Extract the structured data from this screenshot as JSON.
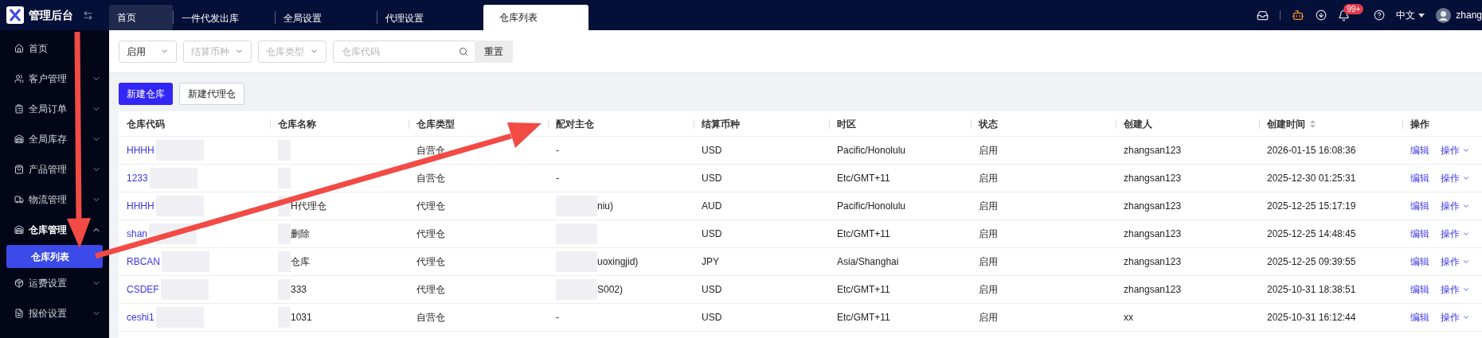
{
  "app": {
    "title": "管理后台"
  },
  "tabs": [
    {
      "label": "首页",
      "selected": false
    },
    {
      "label": "一件代发出库",
      "selected": false
    },
    {
      "label": "全局设置",
      "selected": false
    },
    {
      "label": "代理设置",
      "selected": false
    },
    {
      "label": "仓库列表",
      "selected": true
    }
  ],
  "header": {
    "badge": "99+",
    "language": "中文",
    "user": "zhang"
  },
  "sidebar": {
    "items": [
      {
        "label": "首页",
        "kind": "link"
      },
      {
        "label": "客户管理",
        "kind": "group",
        "expanded": false
      },
      {
        "label": "全局订单",
        "kind": "group",
        "expanded": false
      },
      {
        "label": "全局库存",
        "kind": "group",
        "expanded": false
      },
      {
        "label": "产品管理",
        "kind": "group",
        "expanded": false
      },
      {
        "label": "物流管理",
        "kind": "group",
        "expanded": false
      },
      {
        "label": "仓库管理",
        "kind": "group",
        "expanded": true,
        "children": [
          {
            "label": "仓库列表",
            "selected": true
          }
        ]
      },
      {
        "label": "运费设置",
        "kind": "group",
        "expanded": false
      },
      {
        "label": "报价设置",
        "kind": "group",
        "expanded": false
      }
    ]
  },
  "filters": [
    {
      "kind": "select",
      "value": "启用"
    },
    {
      "kind": "select",
      "placeholder": "结算币种"
    },
    {
      "kind": "select",
      "placeholder": "仓库类型"
    },
    {
      "kind": "search",
      "placeholder": "仓库代码"
    }
  ],
  "reset_button": "重置",
  "actions": [
    {
      "label": "新建仓库",
      "primary": true
    },
    {
      "label": "新建代理仓",
      "primary": false
    }
  ],
  "table": {
    "columns": [
      {
        "label": "仓库代码",
        "sortable": false
      },
      {
        "label": "仓库名称",
        "sortable": false
      },
      {
        "label": "仓库类型",
        "sortable": false
      },
      {
        "label": "配对主仓",
        "sortable": false
      },
      {
        "label": "结算币种",
        "sortable": false
      },
      {
        "label": "时区",
        "sortable": false
      },
      {
        "label": "状态",
        "sortable": false
      },
      {
        "label": "创建人",
        "sortable": false
      },
      {
        "label": "创建时间",
        "sortable": true
      },
      {
        "label": "操作",
        "sortable": false
      }
    ],
    "rows": [
      {
        "code": "HHHH",
        "type": "自营仓",
        "paired": "-",
        "paired_redacted": false,
        "currency": "USD",
        "timezone": "Pacific/Honolulu",
        "status": "启用",
        "creator": "zhangsan123",
        "created": "2026-01-15 16:08:36",
        "edit": "编辑",
        "more": "操作"
      },
      {
        "code": "1233",
        "type": "自营仓",
        "paired": "-",
        "paired_redacted": false,
        "currency": "USD",
        "timezone": "Etc/GMT+11",
        "status": "启用",
        "creator": "zhangsan123",
        "created": "2025-12-30 01:25:31",
        "edit": "编辑",
        "more": "操作"
      },
      {
        "code": "HHHH",
        "name": "H代理仓",
        "type": "代理仓",
        "paired": "niu)",
        "paired_redacted": true,
        "currency": "AUD",
        "timezone": "Pacific/Honolulu",
        "status": "启用",
        "creator": "zhangsan123",
        "created": "2025-12-25 15:17:19",
        "edit": "编辑",
        "more": "操作"
      },
      {
        "code": "shan",
        "name": "删除",
        "type": "代理仓",
        "paired_redacted": true,
        "currency": "USD",
        "timezone": "Etc/GMT+11",
        "status": "启用",
        "creator": "zhangsan123",
        "created": "2025-12-25 14:48:45",
        "edit": "编辑",
        "more": "操作"
      },
      {
        "code": "RBCAN",
        "name": "仓库",
        "type": "代理仓",
        "paired": "uoxingjid)",
        "paired_redacted": true,
        "currency": "JPY",
        "timezone": "Asia/Shanghai",
        "status": "启用",
        "creator": "zhangsan123",
        "created": "2025-12-25 09:39:55",
        "edit": "编辑",
        "more": "操作"
      },
      {
        "code": "CSDEF",
        "name": "333",
        "type": "代理仓",
        "paired": "S002)",
        "paired_redacted": true,
        "currency": "USD",
        "timezone": "Etc/GMT+11",
        "status": "启用",
        "creator": "zhangsan123",
        "created": "2025-10-31 18:38:51",
        "edit": "编辑",
        "more": "操作"
      },
      {
        "code": "ceshi1",
        "name": "1031",
        "type": "自营仓",
        "paired": "-",
        "paired_redacted": false,
        "currency": "USD",
        "timezone": "Etc/GMT+11",
        "status": "启用",
        "creator": "xx",
        "created": "2025-10-31 16:12:44",
        "edit": "编辑",
        "more": "操作"
      }
    ]
  }
}
